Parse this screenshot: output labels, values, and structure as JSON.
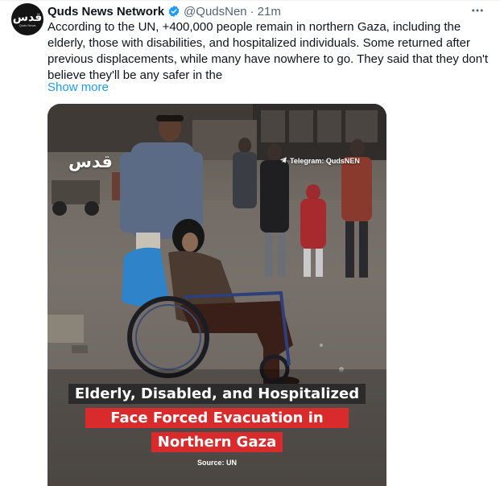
{
  "tweet": {
    "author_name": "Quds News Network",
    "handle": "@QudsNen",
    "separator": "·",
    "time": "21m",
    "more_icon": "more-horizontal-icon",
    "verified_icon": "verified-badge-icon",
    "text": "According to the UN, +400,000 people remain in northern Gaza, including the elderly, those with disabilities, and hospitalized individuals. Some returned after previous displacements, while many have nowhere to go. They said that they don't believe they'll be any safer in the",
    "show_more": "Show more"
  },
  "avatar": {
    "logo_text": "قدس",
    "sub_text": "Quds News"
  },
  "media": {
    "watermark_logo": "قدس",
    "telegram_label": "Telegram: QudsNEN",
    "headline_line1": "Elderly, Disabled, and Hospitalized",
    "headline_line2": "Face Forced Evacuation in",
    "headline_line3": "Northern Gaza",
    "source": "Source: UN"
  },
  "colors": {
    "link": "#1d9bf0",
    "verified": "#1d9bf0",
    "banner_red": "#d92b2b",
    "banner_dark": "#2b2b2b",
    "secondary_text": "#536471"
  }
}
